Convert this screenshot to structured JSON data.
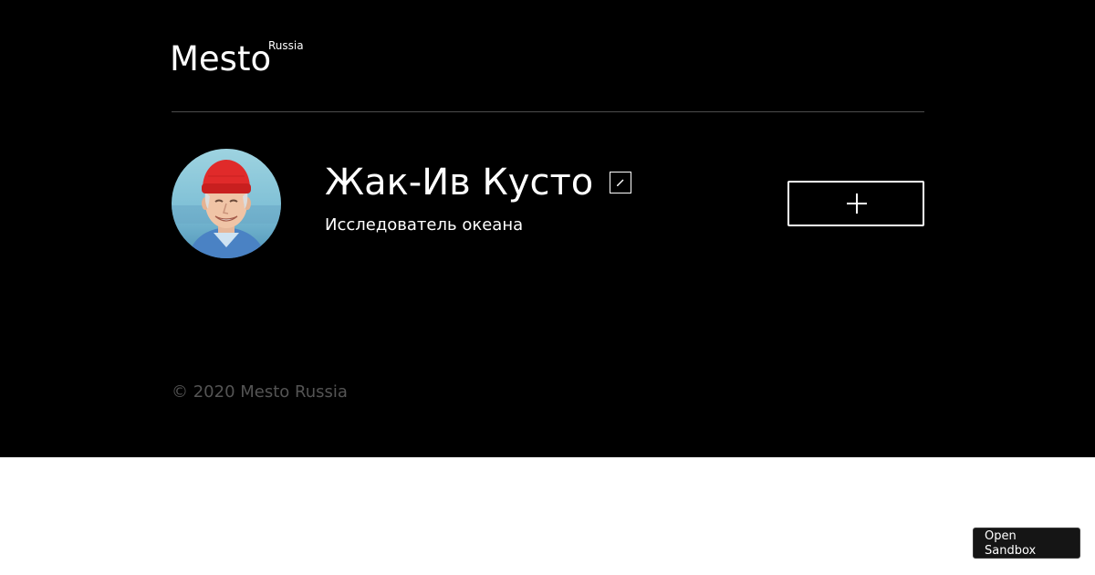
{
  "header": {
    "logo_text": "Mesto",
    "logo_region": "Russia"
  },
  "profile": {
    "name": "Жак-Ив Кусто",
    "about": "Исследователь океана",
    "avatar_alt": "Аватар"
  },
  "footer": {
    "copyright": "© 2020 Mesto Russia"
  },
  "sandbox": {
    "label_line1": "Open",
    "label_line2": "Sandbox"
  },
  "colors": {
    "page_background": "#000000",
    "text": "#ffffff",
    "muted_text": "#545454",
    "divider": "#545454",
    "hat": "#e02a2a"
  },
  "icons": {
    "edit": "pencil-icon",
    "add": "plus-icon"
  }
}
